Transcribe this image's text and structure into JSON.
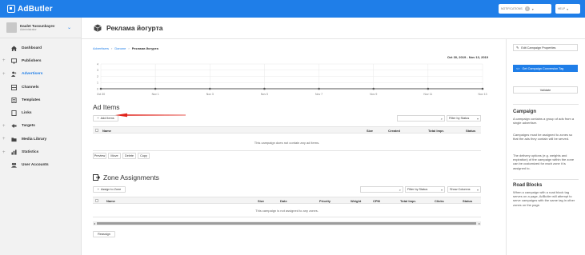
{
  "app": {
    "logo_text": "AdButler",
    "notifications_label": "NOTIFICATIONS",
    "notifications_count": "0",
    "help_label": "HELP"
  },
  "user": {
    "name": "Daulet Tussunbayev",
    "role": "Administrator"
  },
  "sidebar": {
    "items": [
      {
        "label": "Dashboard",
        "icon": "home-icon",
        "expandable": false,
        "active": false
      },
      {
        "label": "Publishers",
        "icon": "monitor-icon",
        "expandable": true,
        "active": false
      },
      {
        "label": "Advertisers",
        "icon": "people-icon",
        "expandable": true,
        "active": true
      },
      {
        "label": "Channels",
        "icon": "channels-icon",
        "expandable": false,
        "active": false
      },
      {
        "label": "Templates",
        "icon": "template-icon",
        "expandable": false,
        "active": false
      },
      {
        "label": "Links",
        "icon": "link-icon",
        "expandable": false,
        "active": false
      },
      {
        "label": "Targets",
        "icon": "target-icon",
        "expandable": true,
        "active": false
      },
      {
        "label": "Media Library",
        "icon": "folder-icon",
        "expandable": true,
        "active": false
      },
      {
        "label": "Statistics",
        "icon": "stats-icon",
        "expandable": true,
        "active": false
      },
      {
        "label": "User Accounts",
        "icon": "users-icon",
        "expandable": false,
        "active": false
      }
    ]
  },
  "page": {
    "title": "Реклама йогурта"
  },
  "breadcrumb": {
    "items": [
      "Advertisers",
      "Danone",
      "Реклама йогурта"
    ],
    "separator": "›"
  },
  "chart_data": {
    "type": "line",
    "date_range": "Oct 30, 2019 - Nov 13, 2019",
    "x": [
      "Oct 30",
      "Nov 1",
      "Nov 3",
      "Nov 5",
      "Nov 7",
      "Nov 9",
      "Nov 11",
      "Nov 13"
    ],
    "y_ticks": [
      0,
      1,
      2,
      3,
      4
    ],
    "ylim": [
      0,
      4
    ],
    "series": [
      {
        "values": [
          0,
          0,
          0,
          0,
          0,
          0,
          0,
          0
        ]
      }
    ],
    "colors": {
      "line": "#555555",
      "grid": "#e8e8e8"
    }
  },
  "ad_items": {
    "title": "Ad Items",
    "add_button": "Add Items",
    "filter_label": "Filter by Status",
    "columns": [
      "Name",
      "Size",
      "Created",
      "Total Impr.",
      "Status"
    ],
    "empty_message": "This campaign does not contain any ad items.",
    "actions": [
      "Preview",
      "Move",
      "Delete",
      "Copy"
    ]
  },
  "zone_assignments": {
    "title": "Zone Assignments",
    "assign_button": "Assign to Zone",
    "filter_label": "Filter by Status",
    "columns_label": "Show Columns",
    "columns": [
      "Name",
      "Size",
      "Date",
      "Priority",
      "Weight",
      "CPM",
      "Total Impr.",
      "Clicks",
      "Status"
    ],
    "empty_message": "This campaign is not assigned to any zones.",
    "action": "Reassign"
  },
  "right_panel": {
    "edit_button": "Edit Campaign Properties",
    "conversion_button": "Get Campaign Conversion Tag",
    "validate_button": "Validate",
    "campaign_heading": "Campaign",
    "campaign_p1": "A campaign contains a group of ads from a single advertiser.",
    "campaign_p2": "Campaigns must be assigned to zones so that the ads they contain will be served.",
    "campaign_p3": "The delivery options (e.g. weights and expiration) of the campaign within the zone can be customized for each zone it is assigned to.",
    "roadblocks_heading": "Road Blocks",
    "roadblocks_text": "When a campaign with a road block tag serves on a page, AdButler will attempt to serve campaigns with the same tag in other zones on the page."
  },
  "colors": {
    "brand": "#1f7ee8",
    "annotation_arrow": "#e0231b"
  }
}
